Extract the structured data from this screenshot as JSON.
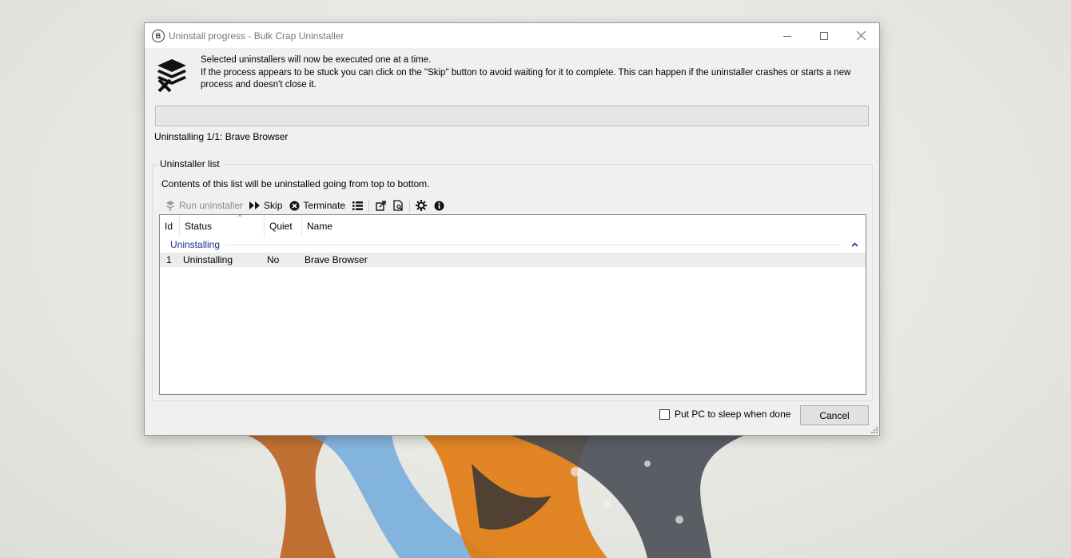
{
  "window": {
    "title": "Uninstall progress - Bulk Crap Uninstaller",
    "app_icon_letter": "B"
  },
  "header": {
    "line1": "Selected uninstallers will now be executed one at a time.",
    "line2": "If the process appears to be stuck you can click on the \"Skip\" button to avoid waiting for it to complete. This can happen if the uninstaller crashes or starts a new process and doesn't close it."
  },
  "progress": {
    "fraction": 0.0,
    "status": "Uninstalling 1/1: Brave Browser"
  },
  "uninstaller_list": {
    "title": "Uninstaller list",
    "description": "Contents of this list will be uninstalled going from top to bottom.",
    "toolbar": {
      "run_uninstaller": "Run uninstaller",
      "skip": "Skip",
      "terminate": "Terminate"
    },
    "columns": [
      "Id",
      "Status",
      "Quiet",
      "Name"
    ],
    "groups": [
      {
        "label": "Uninstalling",
        "rows": [
          {
            "id": "1",
            "status": "Uninstalling",
            "quiet": "No",
            "name": "Brave Browser"
          }
        ]
      }
    ]
  },
  "footer": {
    "sleep_label": "Put PC to sleep when done",
    "sleep_checked": false,
    "cancel_label": "Cancel"
  },
  "colors": {
    "group_label": "#1e3287",
    "progress_fill": "#06b025"
  }
}
